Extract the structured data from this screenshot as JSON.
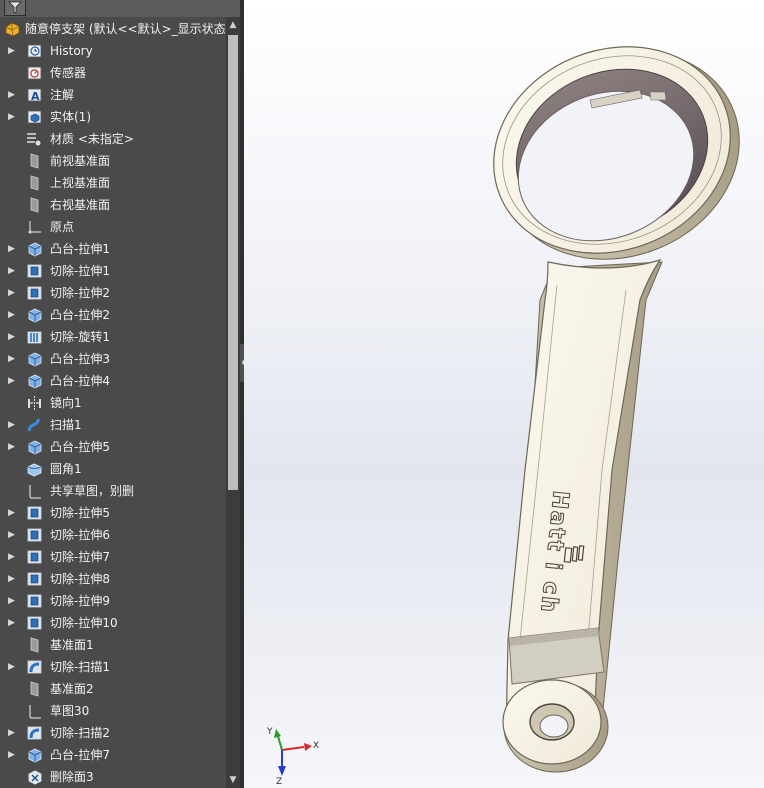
{
  "tree": {
    "filter_icon": "funnel-icon",
    "root": {
      "label": "随意停支架 (默认<<默认>_显示状态",
      "icon": "part-icon"
    },
    "items": [
      {
        "label": "History",
        "icon": "history-icon",
        "expandable": true
      },
      {
        "label": "传感器",
        "icon": "sensor-icon",
        "expandable": false
      },
      {
        "label": "注解",
        "icon": "annotation-icon",
        "expandable": true
      },
      {
        "label": "实体(1)",
        "icon": "solid-bodies-icon",
        "expandable": true
      },
      {
        "label": "材质 <未指定>",
        "icon": "material-icon",
        "expandable": false
      },
      {
        "label": "前视基准面",
        "icon": "plane-icon",
        "expandable": false
      },
      {
        "label": "上视基准面",
        "icon": "plane-icon",
        "expandable": false
      },
      {
        "label": "右视基准面",
        "icon": "plane-icon",
        "expandable": false
      },
      {
        "label": "原点",
        "icon": "origin-icon",
        "expandable": false
      },
      {
        "label": "凸台-拉伸1",
        "icon": "boss-extrude-icon",
        "expandable": true
      },
      {
        "label": "切除-拉伸1",
        "icon": "cut-extrude-icon",
        "expandable": true
      },
      {
        "label": "切除-拉伸2",
        "icon": "cut-extrude-icon",
        "expandable": true
      },
      {
        "label": "凸台-拉伸2",
        "icon": "boss-extrude-icon",
        "expandable": true
      },
      {
        "label": "切除-旋转1",
        "icon": "cut-revolve-icon",
        "expandable": true
      },
      {
        "label": "凸台-拉伸3",
        "icon": "boss-extrude-icon",
        "expandable": true
      },
      {
        "label": "凸台-拉伸4",
        "icon": "boss-extrude-icon",
        "expandable": true
      },
      {
        "label": "镜向1",
        "icon": "mirror-icon",
        "expandable": false
      },
      {
        "label": "扫描1",
        "icon": "sweep-icon",
        "expandable": true
      },
      {
        "label": "凸台-拉伸5",
        "icon": "boss-extrude-icon",
        "expandable": true
      },
      {
        "label": "圆角1",
        "icon": "fillet-icon",
        "expandable": false
      },
      {
        "label": "共享草图，别删",
        "icon": "sketch-icon",
        "expandable": false
      },
      {
        "label": "切除-拉伸5",
        "icon": "cut-extrude-icon",
        "expandable": true
      },
      {
        "label": "切除-拉伸6",
        "icon": "cut-extrude-icon",
        "expandable": true
      },
      {
        "label": "切除-拉伸7",
        "icon": "cut-extrude-icon",
        "expandable": true
      },
      {
        "label": "切除-拉伸8",
        "icon": "cut-extrude-icon",
        "expandable": true
      },
      {
        "label": "切除-拉伸9",
        "icon": "cut-extrude-icon",
        "expandable": true
      },
      {
        "label": "切除-拉伸10",
        "icon": "cut-extrude-icon",
        "expandable": true
      },
      {
        "label": "基准面1",
        "icon": "plane-icon",
        "expandable": false
      },
      {
        "label": "切除-扫描1",
        "icon": "cut-sweep-icon",
        "expandable": true
      },
      {
        "label": "基准面2",
        "icon": "plane-icon",
        "expandable": false
      },
      {
        "label": "草图30",
        "icon": "sketch-icon",
        "expandable": false
      },
      {
        "label": "切除-扫描2",
        "icon": "cut-sweep-icon",
        "expandable": true
      },
      {
        "label": "凸台-拉伸7",
        "icon": "boss-extrude-icon",
        "expandable": true
      },
      {
        "label": "删除面3",
        "icon": "delete-face-icon",
        "expandable": false
      }
    ]
  },
  "scrollbar": {
    "up_icon": "scroll-up-arrow-icon",
    "down_icon": "scroll-down-arrow-icon"
  },
  "model": {
    "engraved_text": "Hatt i ch"
  },
  "triad": {
    "x": "X",
    "y": "Y",
    "z": "Z"
  }
}
